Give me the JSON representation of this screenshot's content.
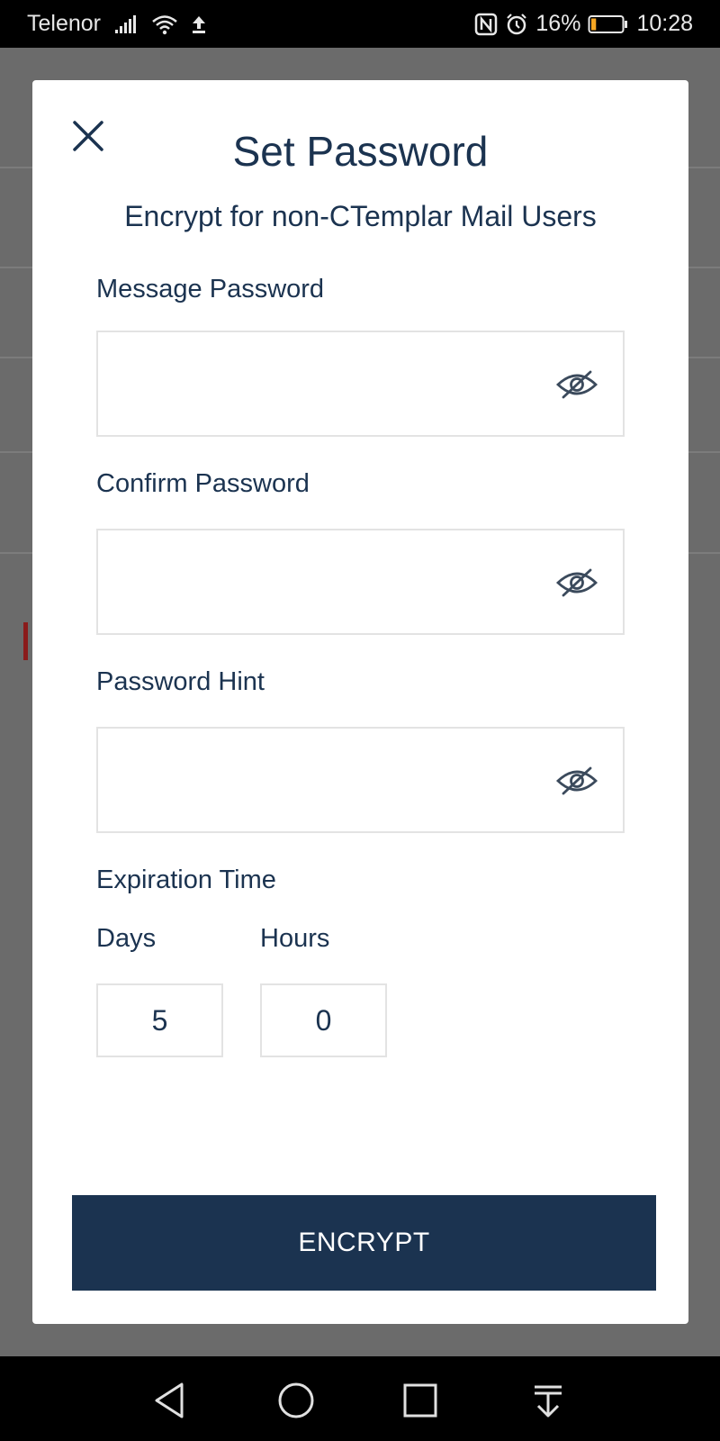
{
  "status_bar": {
    "carrier": "Telenor",
    "battery_percent": "16%",
    "time": "10:28",
    "battery_level": 0.16,
    "battery_color": "#f5a623",
    "icons": [
      "signal-icon",
      "wifi-icon",
      "upload-icon",
      "nfc-icon",
      "alarm-icon",
      "battery-icon"
    ]
  },
  "dialog": {
    "title": "Set Password",
    "subtitle": "Encrypt for non-CTemplar Mail Users",
    "fields": [
      {
        "label": "Message Password",
        "value": ""
      },
      {
        "label": "Confirm Password",
        "value": ""
      },
      {
        "label": "Password Hint",
        "value": ""
      }
    ],
    "expiration": {
      "label": "Expiration Time",
      "days_label": "Days",
      "days_value": "5",
      "hours_label": "Hours",
      "hours_value": "0"
    },
    "encrypt_label": "ENCRYPT"
  },
  "colors": {
    "primary": "#1b3350",
    "backdrop": "#6b6b6b",
    "input_border": "#e3e3e3"
  },
  "nav_bar": {
    "icons": [
      "back-icon",
      "home-icon",
      "recents-icon",
      "notification-shade-icon"
    ]
  }
}
